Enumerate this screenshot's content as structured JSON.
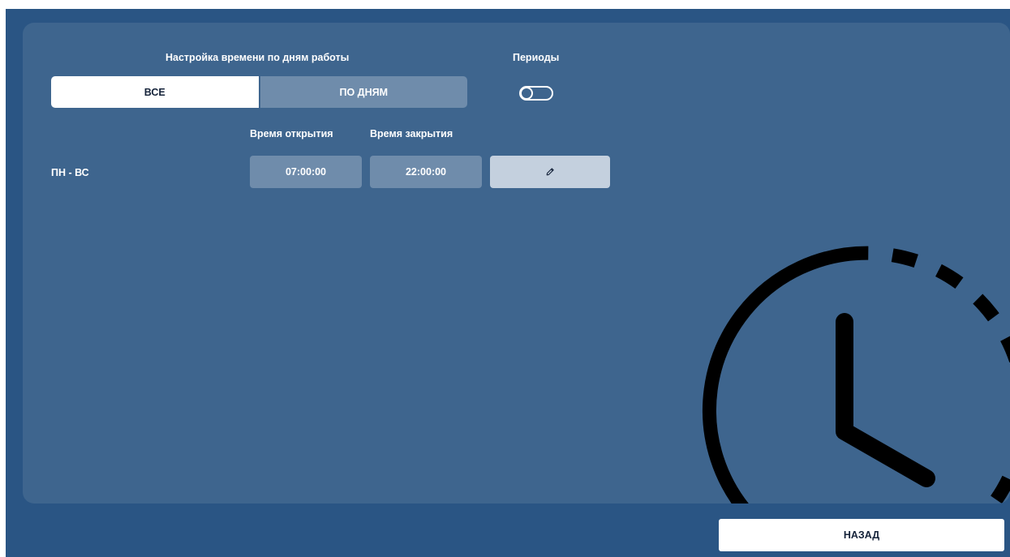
{
  "schedule": {
    "heading": "Настройка времени по дням работы",
    "modes": [
      {
        "label": "ВСЕ",
        "active": true
      },
      {
        "label": "ПО ДНЯМ",
        "active": false
      }
    ]
  },
  "periods": {
    "heading": "Периоды",
    "enabled": false
  },
  "columns": {
    "open": "Время открытия",
    "close": "Время закрытия"
  },
  "rows": [
    {
      "days": "ПН - ВС",
      "open": "07:00:00",
      "close": "22:00:00",
      "edit_icon": "pencil-icon"
    }
  ],
  "footer": {
    "back_label": "НАЗАД"
  },
  "decoration": {
    "icon": "clock-icon"
  },
  "colors": {
    "background": "#2a5584",
    "panel": "#3e658e",
    "field": "#6f8cab",
    "edit_button": "#c4d0de",
    "active_segment": "#ffffff"
  }
}
